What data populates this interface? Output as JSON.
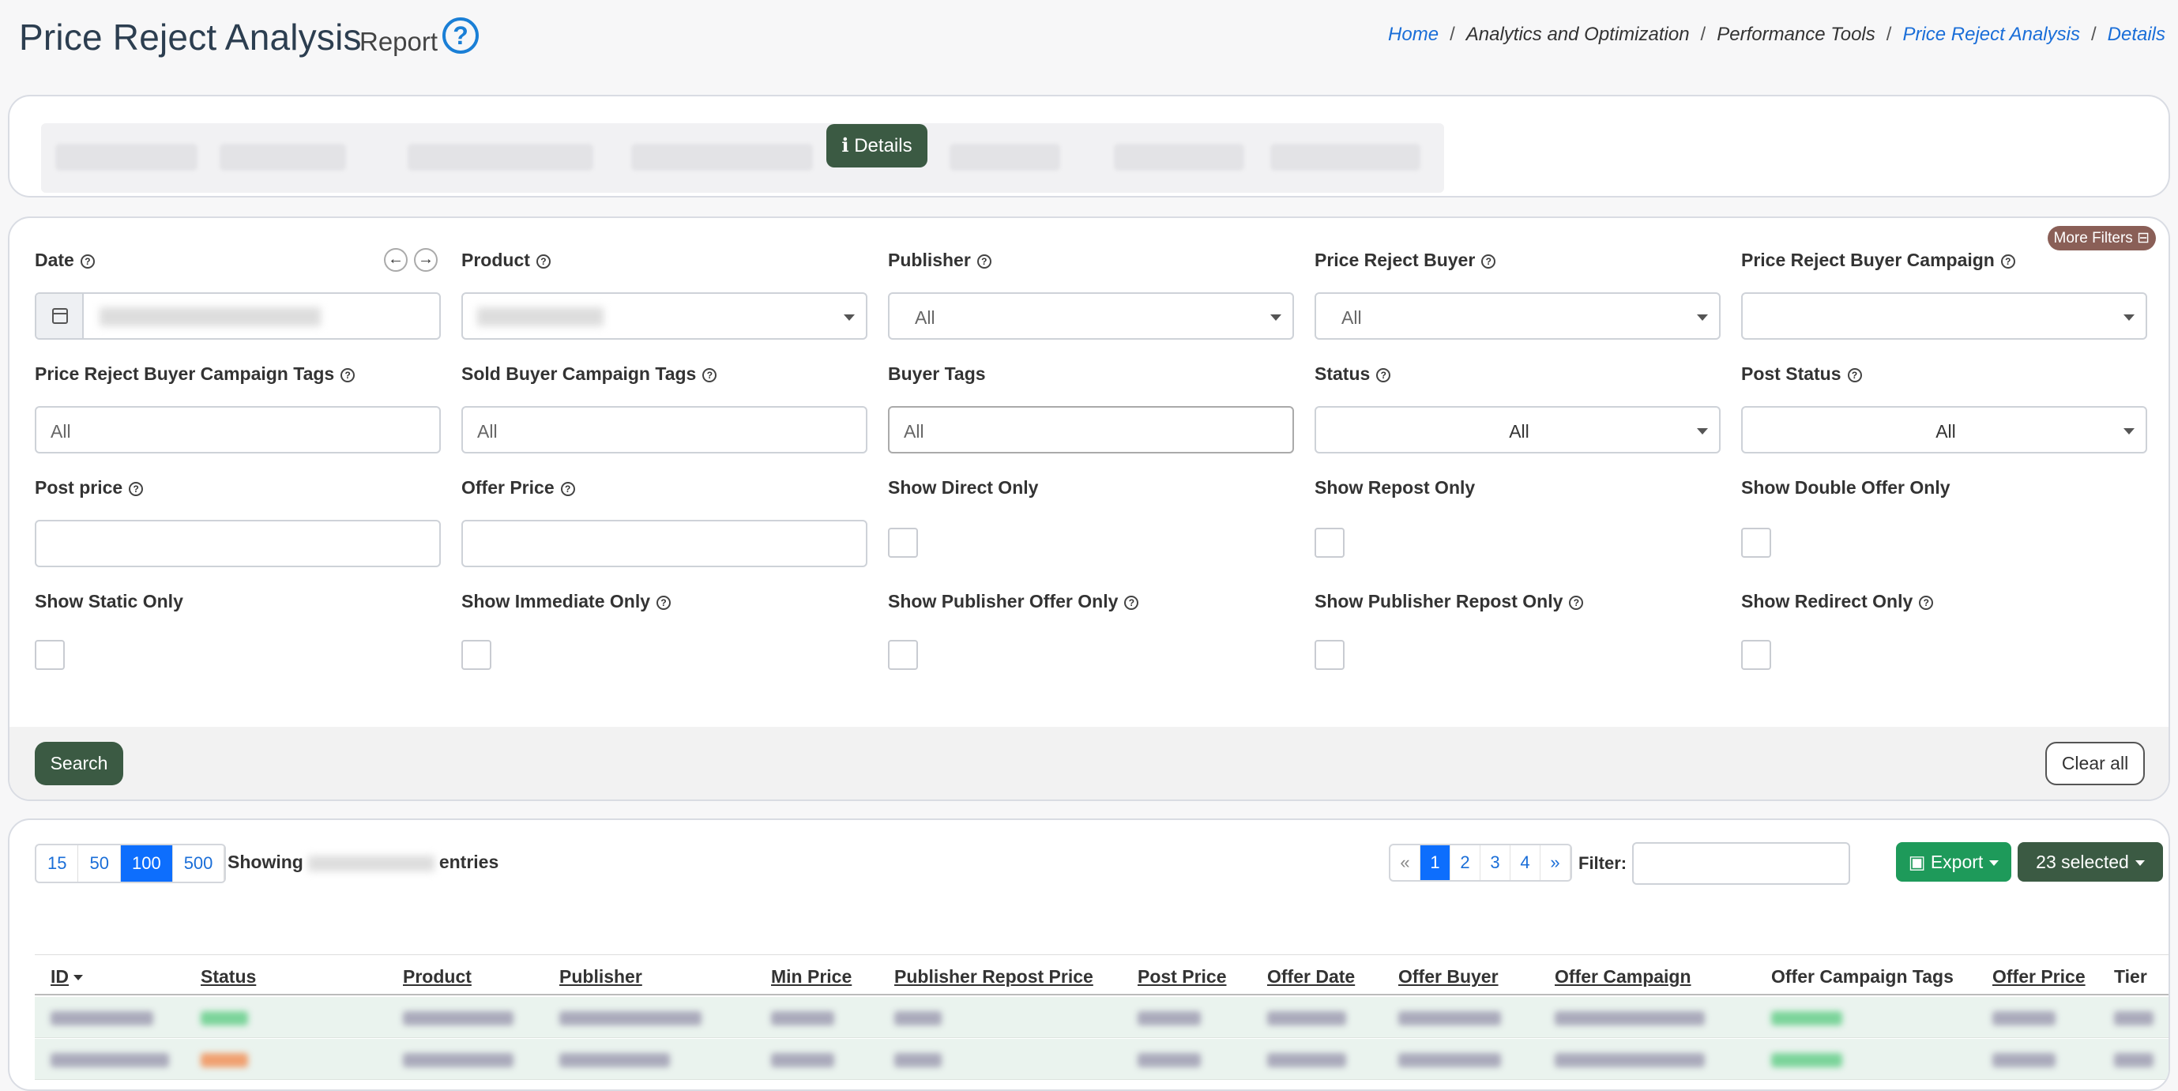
{
  "header": {
    "title": "Price Reject Analysis",
    "subtitle": "Report",
    "help_glyph": "?",
    "breadcrumb": [
      "Home",
      "Analytics and Optimization",
      "Performance Tools",
      "Price Reject Analysis",
      "Details"
    ],
    "breadcrumb_sep": "/"
  },
  "tabs": {
    "active_label": "Details",
    "active_icon": "info-icon"
  },
  "filters": {
    "more_filters_label": "More Filters",
    "date": {
      "label": "Date"
    },
    "product": {
      "label": "Product"
    },
    "publisher": {
      "label": "Publisher",
      "value": "All"
    },
    "price_reject_buyer": {
      "label": "Price Reject Buyer",
      "value": "All"
    },
    "price_reject_buyer_campaign": {
      "label": "Price Reject Buyer Campaign",
      "value": ""
    },
    "price_reject_buyer_campaign_tags": {
      "label": "Price Reject Buyer Campaign Tags",
      "placeholder": "All"
    },
    "sold_buyer_campaign_tags": {
      "label": "Sold Buyer Campaign Tags",
      "placeholder": "All"
    },
    "buyer_tags": {
      "label": "Buyer Tags",
      "placeholder": "All"
    },
    "status": {
      "label": "Status",
      "value": "All"
    },
    "post_status": {
      "label": "Post Status",
      "value": "All"
    },
    "post_price": {
      "label": "Post price"
    },
    "offer_price": {
      "label": "Offer Price"
    },
    "show_direct_only": "Show Direct Only",
    "show_repost_only": "Show Repost Only",
    "show_double_offer_only": "Show Double Offer Only",
    "show_static_only": "Show Static Only",
    "show_immediate_only": "Show Immediate Only",
    "show_publisher_offer_only": "Show Publisher Offer Only",
    "show_publisher_repost_only": "Show Publisher Repost Only",
    "show_redirect_only": "Show Redirect Only",
    "search_label": "Search",
    "clear_label": "Clear all"
  },
  "table": {
    "page_sizes": [
      "15",
      "50",
      "100",
      "500"
    ],
    "active_page_size": "100",
    "showing_prefix": "Showing",
    "showing_suffix": "entries",
    "pager": [
      "«",
      "1",
      "2",
      "3",
      "4",
      "»"
    ],
    "active_page": "1",
    "filter_label": "Filter:",
    "export_label": "Export",
    "selected_label": "23 selected",
    "columns": [
      "ID",
      "Status",
      "Product",
      "Publisher",
      "Min Price",
      "Publisher Repost Price",
      "Post Price",
      "Offer Date",
      "Offer Buyer",
      "Offer Campaign",
      "Offer Campaign Tags",
      "Offer Price",
      "Tier"
    ]
  },
  "colors": {
    "primary_dark_green": "#3b5a43",
    "export_green": "#1e9a5a",
    "link_blue": "#1a6ed8",
    "active_blue": "#0d6efd",
    "more_filters_brown": "#8a5f57"
  }
}
